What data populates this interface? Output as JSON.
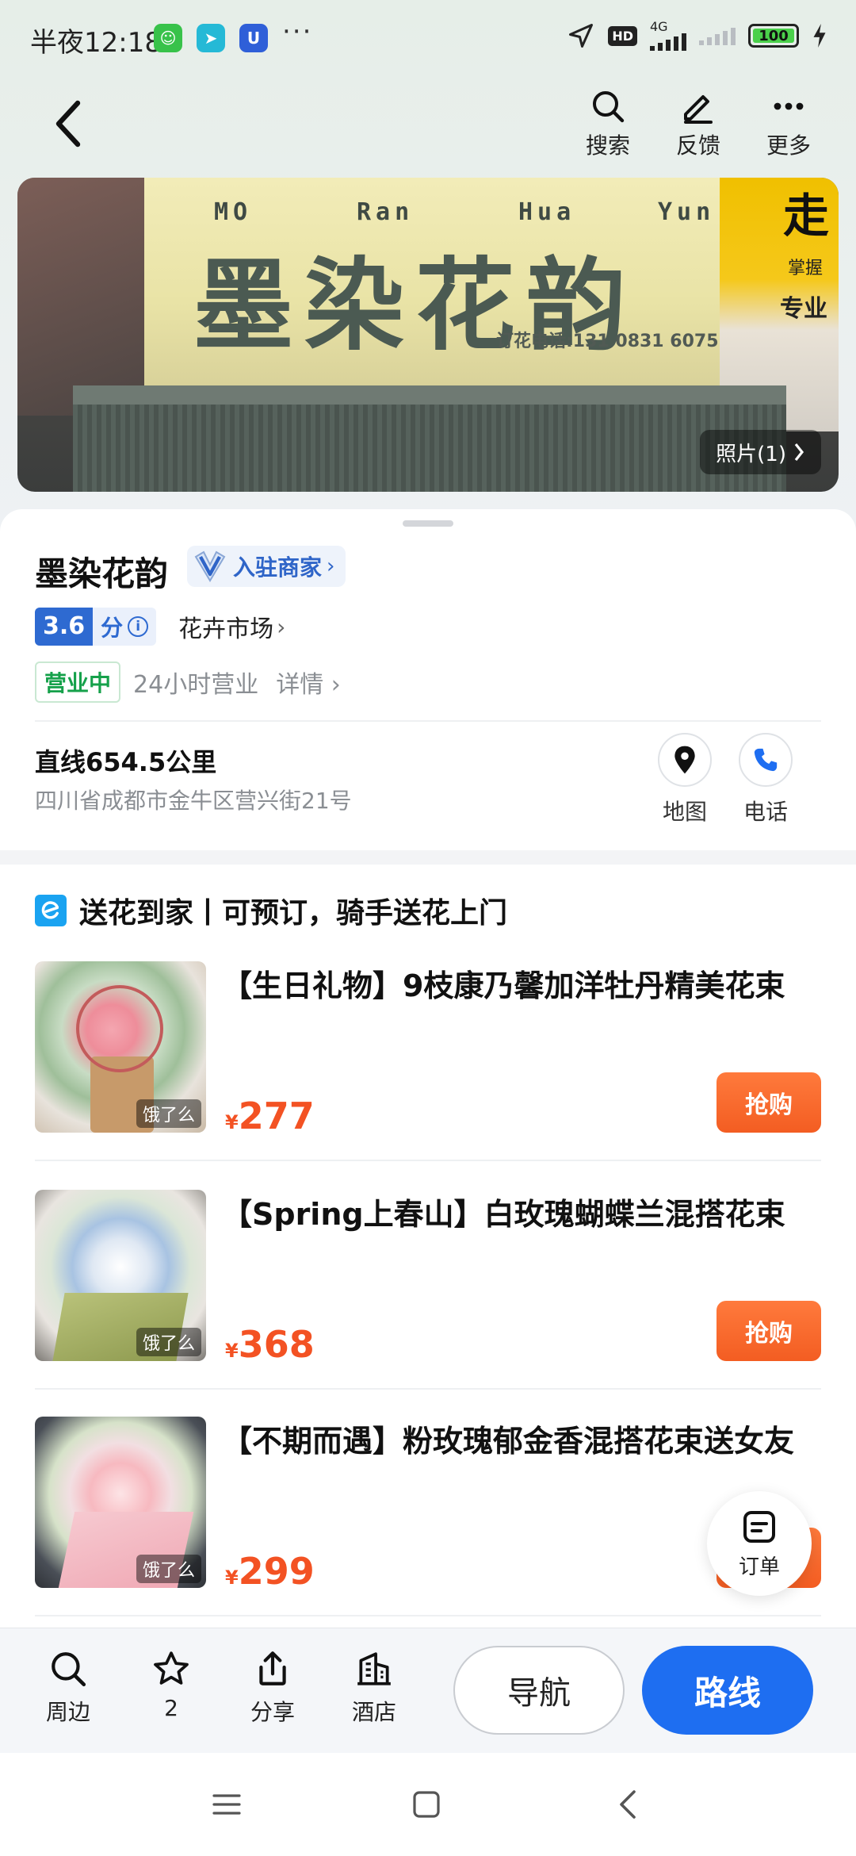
{
  "status_bar": {
    "time": "半夜12:18",
    "more": "···",
    "network": "4G",
    "hd": "HD",
    "battery": "100"
  },
  "header": {
    "actions": [
      {
        "label": "搜索",
        "icon": "search-icon"
      },
      {
        "label": "反馈",
        "icon": "feedback-pen-icon"
      },
      {
        "label": "更多",
        "icon": "more-dots-icon"
      }
    ]
  },
  "banner": {
    "pinyin": [
      "MO",
      "Ran",
      "Hua",
      "Yun"
    ],
    "sign_title": "墨染花韵",
    "sign_phone": "订花电话:131 0831 6075",
    "neighbor_sign_main": "走",
    "neighbor_sign_sub": "掌握",
    "neighbor_sign_zy": "专业",
    "photo_count": "照片(1)"
  },
  "shop": {
    "name": "墨染花韵",
    "merchant_tag": "入驻商家",
    "rating": "3.6",
    "rating_unit": "分",
    "category": "花卉市场",
    "status": "营业中",
    "hours": "24小时营业",
    "detail": "详情",
    "distance": "直线654.5公里",
    "address": "四川省成都市金牛区营兴街21号",
    "actions": [
      {
        "label": "地图",
        "icon": "map-pin-icon"
      },
      {
        "label": "电话",
        "icon": "phone-icon"
      }
    ]
  },
  "delivery": {
    "title": "送花到家丨可预订，骑手送花上门",
    "source_label": "饿了么",
    "currency": "¥",
    "buy_label": "抢购",
    "products": [
      {
        "title": "【生日礼物】9枝康乃馨加洋牡丹精美花束",
        "price": "277"
      },
      {
        "title": "【Spring上春山】白玫瑰蝴蝶兰混搭花束",
        "price": "368"
      },
      {
        "title": "【不期而遇】粉玫瑰郁金香混搭花束送女友",
        "price": "299"
      }
    ]
  },
  "fab": {
    "label": "订单"
  },
  "toolbar": {
    "items": [
      {
        "label": "周边",
        "icon": "search-icon"
      },
      {
        "label": "2",
        "icon": "star-icon"
      },
      {
        "label": "分享",
        "icon": "share-icon"
      },
      {
        "label": "酒店",
        "icon": "hotel-icon"
      }
    ],
    "navigate": "导航",
    "route": "路线"
  },
  "colors": {
    "accent_blue": "#1e6ef1",
    "price_orange": "#f35223",
    "open_green": "#16a14b"
  }
}
